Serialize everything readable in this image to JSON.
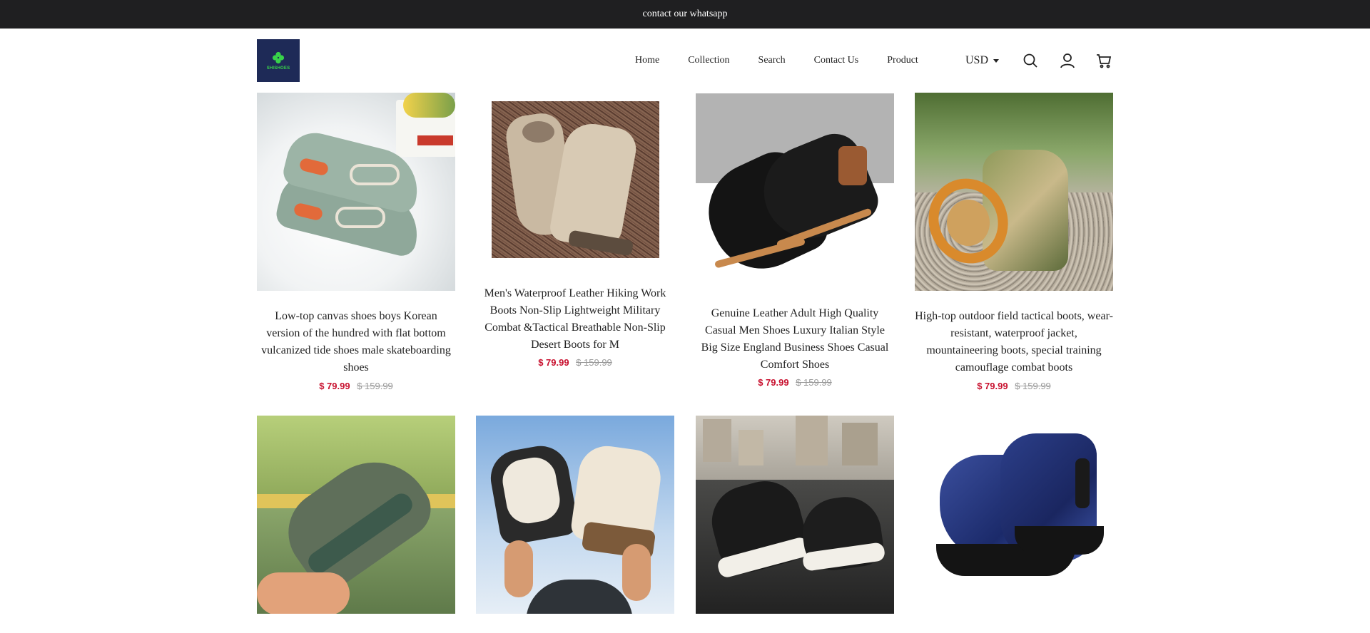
{
  "announcement": {
    "text": "contact our whatsapp"
  },
  "logo": {
    "wordmark": "SHISHOES"
  },
  "nav": {
    "items": [
      "Home",
      "Collection",
      "Search",
      "Contact Us",
      "Product"
    ],
    "currency": "USD"
  },
  "header_icons": [
    "search-icon",
    "account-icon",
    "cart-icon"
  ],
  "colors": {
    "topbar": "#1f1f21",
    "logo_bg": "#1e2a57",
    "logo_accent": "#38d24a",
    "sale_price": "#c8102e",
    "original_price": "#9a9a9a"
  },
  "products": [
    {
      "title": "Low-top canvas shoes boys Korean version of the hundred with flat bottom vulcanized tide shoes male skateboarding shoes",
      "price": "$ 79.99",
      "original_price": "$ 159.99"
    },
    {
      "title": "Men's Waterproof Leather Hiking Work Boots Non-Slip Lightweight Military Combat &Tactical Breathable Non-Slip Desert Boots for M",
      "price": "$ 79.99",
      "original_price": "$ 159.99"
    },
    {
      "title": "Genuine Leather Adult High Quality Casual Men Shoes Luxury Italian Style Big Size England Business Shoes Casual Comfort Shoes",
      "price": "$ 79.99",
      "original_price": "$ 159.99"
    },
    {
      "title": "High-top outdoor field tactical boots, wear-resistant, waterproof jacket, mountaineering boots, special training camouflage combat boots",
      "price": "$ 79.99",
      "original_price": "$ 159.99"
    },
    {
      "title": "",
      "price": "",
      "original_price": ""
    },
    {
      "title": "",
      "price": "",
      "original_price": ""
    },
    {
      "title": "",
      "price": "",
      "original_price": ""
    },
    {
      "title": "",
      "price": "",
      "original_price": ""
    }
  ]
}
